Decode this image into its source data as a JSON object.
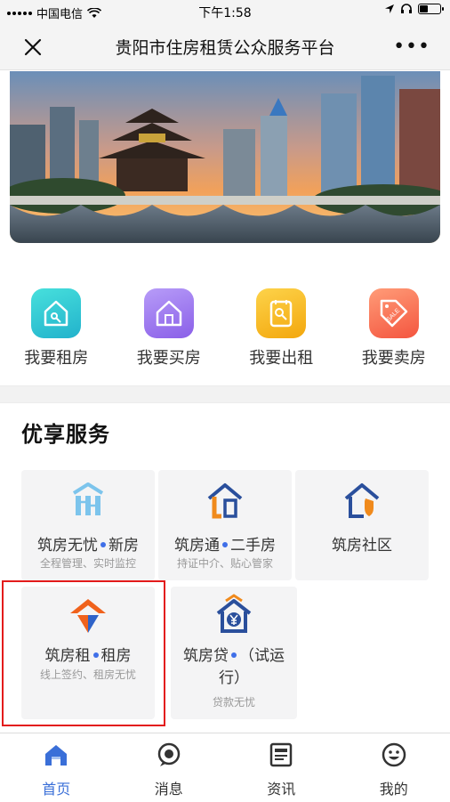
{
  "status_bar": {
    "carrier": "中国电信",
    "time": "下午1:58"
  },
  "nav": {
    "title": "贵阳市住房租赁公众服务平台",
    "more": "•••"
  },
  "quick_actions": [
    {
      "label": "我要租房",
      "icon": "rent-house-icon",
      "color": "#2fc6cf"
    },
    {
      "label": "我要买房",
      "icon": "buy-house-icon",
      "color": "#9a6ff0"
    },
    {
      "label": "我要出租",
      "icon": "lease-out-icon",
      "color": "#f7b517"
    },
    {
      "label": "我要卖房",
      "icon": "sale-tag-icon",
      "color": "#fb6f5a"
    }
  ],
  "section": {
    "title": "优享服务"
  },
  "services": [
    {
      "title": "筑房无忧",
      "suffix": "新房",
      "subtitle": "全程管理、实时监控",
      "icon": "new-house-icon"
    },
    {
      "title": "筑房通",
      "suffix": "二手房",
      "subtitle": "持证中介、贴心管家",
      "icon": "second-hand-house-icon"
    },
    {
      "title": "筑房社区",
      "icon": "community-shield-icon"
    },
    {
      "title": "筑房租",
      "suffix": "租房",
      "subtitle": "线上签约、租房无忧",
      "icon": "rental-house-icon"
    },
    {
      "title": "筑房贷",
      "suffix": "（试运",
      "suffix2": "行）",
      "subtitle": "贷款无忧",
      "icon": "loan-yuan-icon"
    }
  ],
  "tabs": [
    {
      "label": "首页",
      "icon": "home-icon",
      "active": true
    },
    {
      "label": "消息",
      "icon": "message-icon"
    },
    {
      "label": "资讯",
      "icon": "news-icon"
    },
    {
      "label": "我的",
      "icon": "profile-icon"
    }
  ],
  "colors": {
    "accent": "#3a6fd8",
    "highlight_border": "#e31b1b",
    "card_bg": "#f4f4f5"
  }
}
